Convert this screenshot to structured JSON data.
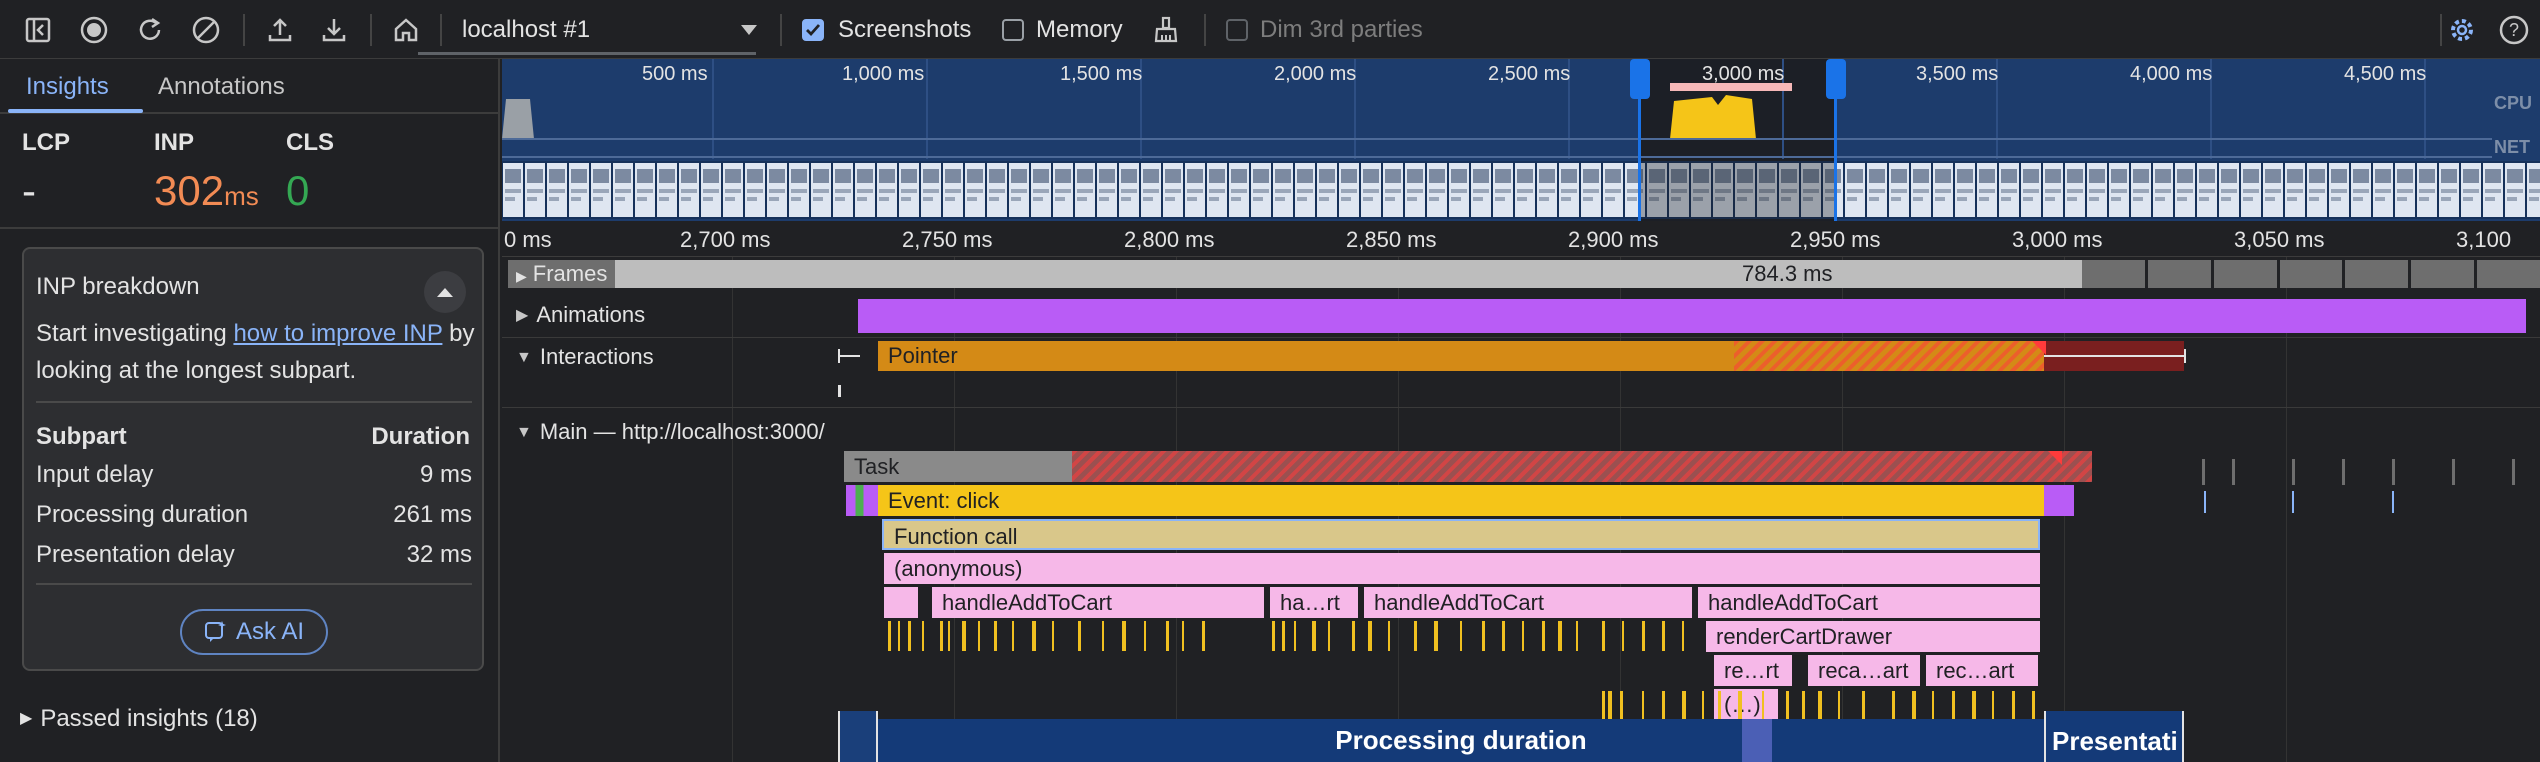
{
  "toolbar": {
    "recording_select": "localhost #1",
    "screenshots_label": "Screenshots",
    "memory_label": "Memory",
    "dim_label": "Dim 3rd parties"
  },
  "sidebar": {
    "tabs": [
      "Insights",
      "Annotations"
    ],
    "metrics": [
      {
        "label": "LCP",
        "value": "-",
        "unit": ""
      },
      {
        "label": "INP",
        "value": "302",
        "unit": "ms"
      },
      {
        "label": "CLS",
        "value": "0",
        "unit": ""
      }
    ],
    "card": {
      "title": "INP breakdown",
      "text_before": "Start investigating ",
      "link": "how to improve INP",
      "text_after": " by looking at the longest subpart.",
      "col_subpart": "Subpart",
      "col_duration": "Duration",
      "rows": [
        {
          "name": "Input delay",
          "value": "9 ms"
        },
        {
          "name": "Processing duration",
          "value": "261 ms"
        },
        {
          "name": "Presentation delay",
          "value": "32 ms"
        }
      ],
      "ask_ai": "Ask AI"
    },
    "passed": "Passed insights (18)"
  },
  "overview": {
    "ticks": [
      "500 ms",
      "1,000 ms",
      "1,500 ms",
      "2,000 ms",
      "2,500 ms",
      "3,000 ms",
      "3,500 ms",
      "4,000 ms",
      "4,500 ms"
    ],
    "cpu_label": "CPU",
    "net_label": "NET"
  },
  "ruler": {
    "ticks": [
      "0 ms",
      "2,700 ms",
      "2,750 ms",
      "2,800 ms",
      "2,850 ms",
      "2,900 ms",
      "2,950 ms",
      "3,000 ms",
      "3,050 ms",
      "3,100"
    ]
  },
  "tracks": {
    "frames_label": "Frames",
    "frames_value": "784.3 ms",
    "animations_label": "Animations",
    "interactions_label": "Interactions",
    "pointer_label": "Pointer",
    "main_label": "Main — http://localhost:3000/",
    "task_label": "Task",
    "event_label": "Event: click",
    "function_label": "Function call",
    "anonymous_label": "(anonymous)",
    "level4": [
      "handleAddToCart",
      "ha…rt",
      "handleAddToCart",
      "handleAddToCart"
    ],
    "render_label": "renderCartDrawer",
    "level6": [
      "re…rt",
      "reca…art",
      "rec…art"
    ],
    "paren_label": "(…)",
    "processing_label": "Processing duration",
    "presentation_label": "Presentati"
  },
  "colors": {
    "accent": "#8ab4f8",
    "inp_value": "#f28b54",
    "cls_value": "#34a853",
    "animation": "#b95cf6",
    "pointer": "#d48a16",
    "event": "#f5c518",
    "task": "#8a8a8a"
  }
}
